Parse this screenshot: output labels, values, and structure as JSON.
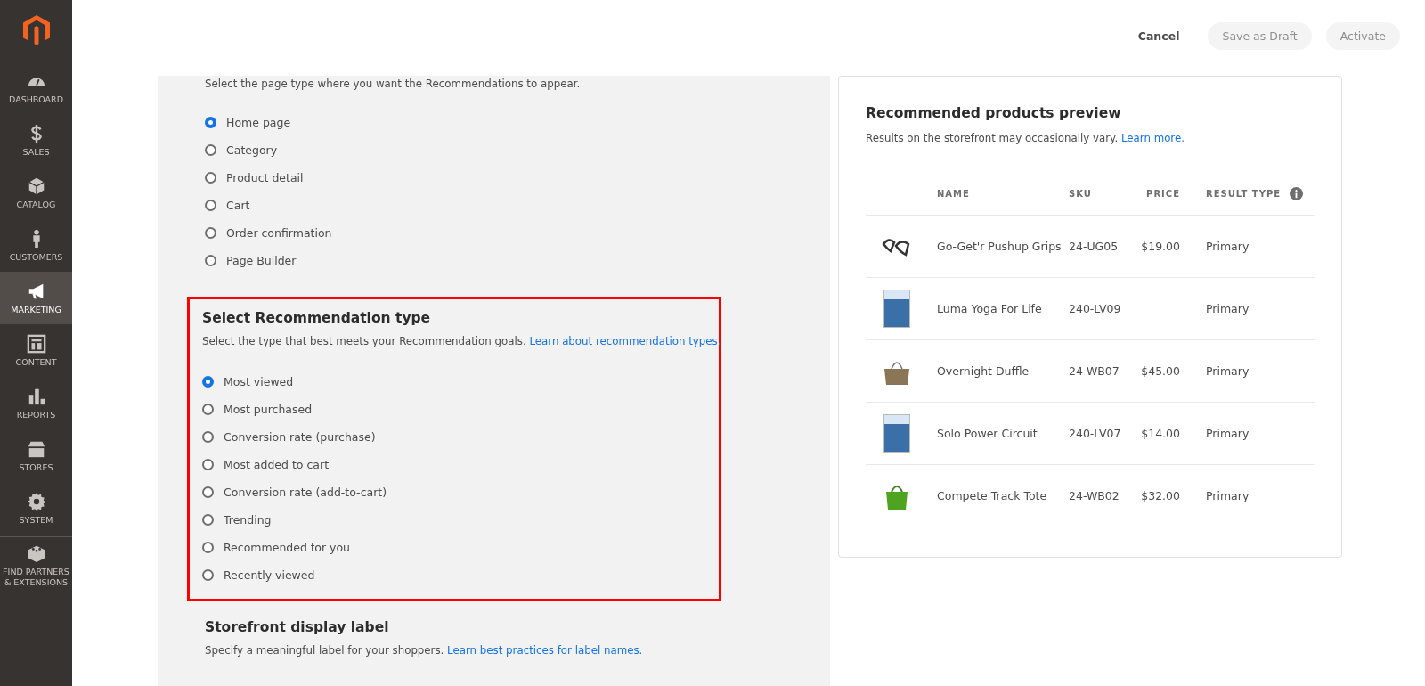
{
  "header": {
    "buttons": [
      {
        "label": "Cancel",
        "disabled": false
      },
      {
        "label": "Save as Draft",
        "disabled": true
      },
      {
        "label": "Activate",
        "disabled": true
      }
    ]
  },
  "sidebar": {
    "items": [
      {
        "label": "DASHBOARD",
        "kind": "gauge",
        "selected": false
      },
      {
        "label": "SALES",
        "kind": "dollar",
        "selected": false
      },
      {
        "label": "CATALOG",
        "kind": "box",
        "selected": false
      },
      {
        "label": "CUSTOMERS",
        "kind": "person",
        "selected": false
      },
      {
        "label": "MARKETING",
        "kind": "megaphone",
        "selected": true
      },
      {
        "label": "CONTENT",
        "kind": "layout",
        "selected": false
      },
      {
        "label": "REPORTS",
        "kind": "bars",
        "selected": false
      },
      {
        "label": "STORES",
        "kind": "store",
        "selected": false
      },
      {
        "label": "SYSTEM",
        "kind": "gear",
        "selected": false
      },
      {
        "label": "FIND PARTNERS & EXTENSIONS",
        "kind": "blocks",
        "selected": false
      }
    ]
  },
  "page_type": {
    "description": "Select the page type where you want the Recommendations to appear.",
    "options": [
      {
        "label": "Home page",
        "selected": true
      },
      {
        "label": "Category",
        "selected": false
      },
      {
        "label": "Product detail",
        "selected": false
      },
      {
        "label": "Cart",
        "selected": false
      },
      {
        "label": "Order confirmation",
        "selected": false
      },
      {
        "label": "Page Builder",
        "selected": false
      }
    ]
  },
  "recommendation_type": {
    "title": "Select Recommendation type",
    "description": "Select the type that best meets your Recommendation goals.",
    "link": "Learn about recommendation types.",
    "highlighted": true,
    "options": [
      {
        "label": "Most viewed",
        "selected": true
      },
      {
        "label": "Most purchased",
        "selected": false
      },
      {
        "label": "Conversion rate (purchase)",
        "selected": false
      },
      {
        "label": "Most added to cart",
        "selected": false
      },
      {
        "label": "Conversion rate (add-to-cart)",
        "selected": false
      },
      {
        "label": "Trending",
        "selected": false
      },
      {
        "label": "Recommended for you",
        "selected": false
      },
      {
        "label": "Recently viewed",
        "selected": false
      }
    ]
  },
  "storefront_label": {
    "title": "Storefront display label",
    "description": "Specify a meaningful label for your shoppers.",
    "link": "Learn best practices for label names."
  },
  "preview": {
    "title": "Recommended products preview",
    "description": "Results on the storefront may occasionally vary.",
    "link": "Learn more.",
    "columns": [
      "NAME",
      "SKU",
      "PRICE",
      "RESULT TYPE"
    ],
    "rows": [
      {
        "name": "Go-Get'r Pushup Grips",
        "sku": "24-UG05",
        "price": "$19.00",
        "result_type": "Primary",
        "kind": "grips"
      },
      {
        "name": "Luma Yoga For Life",
        "sku": "240-LV09",
        "result_type": "Primary",
        "kind": "dvd"
      },
      {
        "name": "Overnight Duffle",
        "sku": "24-WB07",
        "price": "$45.00",
        "result_type": "Primary",
        "kind": "duffle"
      },
      {
        "name": "Solo Power Circuit",
        "sku": "240-LV07",
        "price": "$14.00",
        "result_type": "Primary",
        "kind": "dvd"
      },
      {
        "name": "Compete Track Tote",
        "sku": "24-WB02",
        "price": "$32.00",
        "result_type": "Primary",
        "kind": "tote"
      }
    ]
  }
}
